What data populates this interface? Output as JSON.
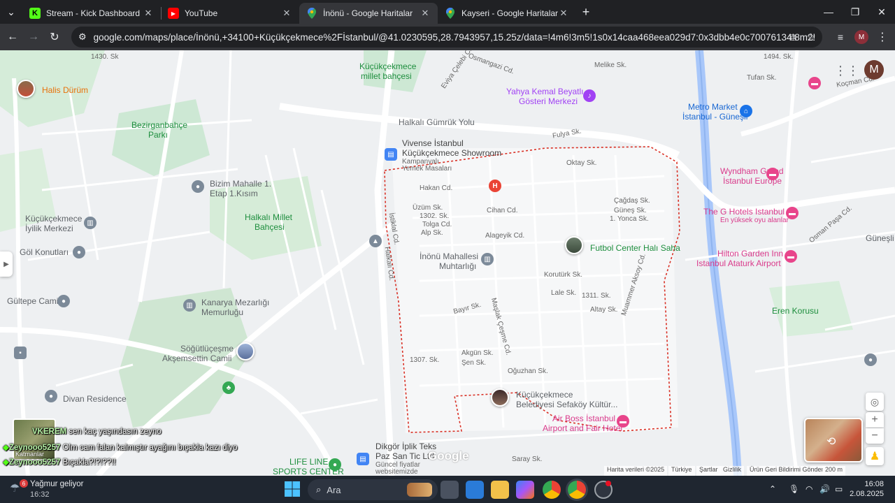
{
  "tabs": [
    {
      "title": "Stream - Kick Dashboard",
      "icon": "kick-icon",
      "color": "#53fc18"
    },
    {
      "title": "YouTube",
      "icon": "youtube-icon",
      "color": "#ff0000"
    },
    {
      "title": "İnönü - Google Haritalar",
      "icon": "maps-pin-icon",
      "color": "#34a853",
      "active": true
    },
    {
      "title": "Kayseri - Google Haritalar",
      "icon": "maps-pin-icon",
      "color": "#34a853"
    }
  ],
  "address_bar": {
    "url": "google.com/maps/place/İnönü,+34100+Küçükçekmece%2Fİstanbul/@41.0230595,28.7943957,15.25z/data=!4m6!3m5!1s0x14caa468eea029d7:0x3dbb4e0c70076134!8m2!3d41.0226458!4d2..."
  },
  "profile_letter": "M",
  "map": {
    "labels": [
      {
        "text": "1430. Sk",
        "cls": "road"
      },
      {
        "text": "Küçükçekmece",
        "cls": "green"
      },
      {
        "text": "millet bahçesi",
        "cls": "green"
      },
      {
        "text": "Eviya Çelebi Cd.",
        "cls": "road"
      },
      {
        "text": "Osmangazi Cd.",
        "cls": "road"
      },
      {
        "text": "Melike Sk.",
        "cls": "road"
      },
      {
        "text": "Halis Dürüm",
        "cls": "orange"
      },
      {
        "text": "Yahya Kemal Beyatlı",
        "cls": "purple"
      },
      {
        "text": "Gösteri Merkezi",
        "cls": "purple"
      },
      {
        "text": "Metro Market",
        "cls": "blue"
      },
      {
        "text": "İstanbul - Güneşli",
        "cls": "blue"
      },
      {
        "text": "Bezirganbahçe",
        "cls": "green"
      },
      {
        "text": "Parkı",
        "cls": "green"
      },
      {
        "text": "Halkalı Gümrük Yolu",
        "cls": "gray"
      },
      {
        "text": "Fulya Sk.",
        "cls": "road"
      },
      {
        "text": "Vivense İstanbul",
        "cls": "poi"
      },
      {
        "text": "Küçükçekmece Showroom",
        "cls": "poi"
      },
      {
        "text": "Kampanyalı",
        "cls": "small"
      },
      {
        "text": "Yemek Masaları",
        "cls": "small"
      },
      {
        "text": "Oktay Sk.",
        "cls": "road"
      },
      {
        "text": "Wyndham Grand",
        "cls": "pink"
      },
      {
        "text": "İstanbul Europe",
        "cls": "pink"
      },
      {
        "text": "Bizim Mahalle 1.",
        "cls": "gray"
      },
      {
        "text": "Etap 1.Kısım",
        "cls": "gray"
      },
      {
        "text": "Hakan Cd.",
        "cls": "road"
      },
      {
        "text": "Üzüm Sk.",
        "cls": "road"
      },
      {
        "text": "1302. Sk.",
        "cls": "road"
      },
      {
        "text": "Tolga Cd.",
        "cls": "road"
      },
      {
        "text": "Alp Sk.",
        "cls": "road"
      },
      {
        "text": "Cihan Cd.",
        "cls": "road"
      },
      {
        "text": "Çağdaş Sk.",
        "cls": "road"
      },
      {
        "text": "Güneş Sk.",
        "cls": "road"
      },
      {
        "text": "1. Yonca Sk.",
        "cls": "road"
      },
      {
        "text": "The G Hotels Istanbul",
        "cls": "pink"
      },
      {
        "text": "En yüksek oyu alanlar",
        "cls": "small"
      },
      {
        "text": "Halkalı Millet",
        "cls": "green"
      },
      {
        "text": "Bahçesi",
        "cls": "green"
      },
      {
        "text": "Küçükçekmece",
        "cls": "gray"
      },
      {
        "text": "İyilik Merkezi",
        "cls": "gray"
      },
      {
        "text": "Alageyik Cd.",
        "cls": "road"
      },
      {
        "text": "Futbol Center Halı Saha",
        "cls": "green"
      },
      {
        "text": "Hilton Garden Inn",
        "cls": "pink"
      },
      {
        "text": "Istanbul Ataturk Airport",
        "cls": "pink"
      },
      {
        "text": "Göl Konutları",
        "cls": "gray"
      },
      {
        "text": "İnönü Mahallesi",
        "cls": "gray"
      },
      {
        "text": "Muhtarlığı",
        "cls": "gray"
      },
      {
        "text": "Korutürk Sk.",
        "cls": "road"
      },
      {
        "text": "Lale Sk.",
        "cls": "road"
      },
      {
        "text": "1311. Sk.",
        "cls": "road"
      },
      {
        "text": "Gültepe Cami",
        "cls": "gray"
      },
      {
        "text": "Kanarya Mezarlığı",
        "cls": "gray"
      },
      {
        "text": "Memurluğu",
        "cls": "gray"
      },
      {
        "text": "Bayır Sk.",
        "cls": "road"
      },
      {
        "text": "Altay Sk.",
        "cls": "road"
      },
      {
        "text": "Eren Korusu",
        "cls": "green"
      },
      {
        "text": "Söğütlüçeşme",
        "cls": "gray"
      },
      {
        "text": "Akşemsettin Camii",
        "cls": "gray"
      },
      {
        "text": "Akgün Sk.",
        "cls": "road"
      },
      {
        "text": "Şen Sk.",
        "cls": "road"
      },
      {
        "text": "1307. Sk.",
        "cls": "road"
      },
      {
        "text": "Oğuzhan Sk.",
        "cls": "road"
      },
      {
        "text": "Divan Residence",
        "cls": "gray"
      },
      {
        "text": "Küçükçekmece",
        "cls": "gray"
      },
      {
        "text": "Belediyesi Sefaköy Kültür...",
        "cls": "gray"
      },
      {
        "text": "Air Boss İstanbul",
        "cls": "pink"
      },
      {
        "text": "Airport and Fair Hotel",
        "cls": "pink"
      },
      {
        "text": "Dikgör İplik Teks",
        "cls": "poi"
      },
      {
        "text": "Paz San Tic Ltd.",
        "cls": "poi"
      },
      {
        "text": "Güncel fiyatlar",
        "cls": "small"
      },
      {
        "text": "websitemizde",
        "cls": "small"
      },
      {
        "text": "LIFE LINE",
        "cls": "green"
      },
      {
        "text": "SPORTS CENTER",
        "cls": "green"
      },
      {
        "text": "Saray Sk.",
        "cls": "road"
      },
      {
        "text": "Güneşli",
        "cls": "gray"
      },
      {
        "text": "Koçman Cd.",
        "cls": "road"
      },
      {
        "text": "Tufan Sk.",
        "cls": "road"
      },
      {
        "text": "1494. Sk.",
        "cls": "road"
      },
      {
        "text": "Osman Paşa Cd.",
        "cls": "road"
      },
      {
        "text": "Maşlak Çeşme Cd.",
        "cls": "road"
      },
      {
        "text": "İstiklal Cd.",
        "cls": "road"
      },
      {
        "text": "Halkalı Cd.",
        "cls": "road"
      },
      {
        "text": "Muammer Aksoy Cd.",
        "cls": "road"
      }
    ],
    "google_logo": "Google",
    "footer": [
      "Harita verileri ©2025",
      "Türkiye",
      "Şartlar",
      "Gizlilik",
      "Ürün Geri Bildirimi Gönder",
      "200 m"
    ]
  },
  "chat": [
    {
      "user": "VKEREM",
      "msg": "sen kaç yaşındasın zeyno"
    },
    {
      "user": "Zeynooo5257",
      "msg": "Olm cam falan kalmıştır ayağını bıçakla kazı diyo"
    },
    {
      "user": "Zeynooo5257",
      "msg": "Bıçakla?!?!??!!"
    }
  ],
  "layers_label": "Katmanlar",
  "taskbar": {
    "weather_badge": "6",
    "weather_text": "Yağmur geliyor",
    "weather_time": "16:32",
    "search_label": "Ara",
    "clock_time": "16:08",
    "clock_date": "2.08.2025"
  }
}
